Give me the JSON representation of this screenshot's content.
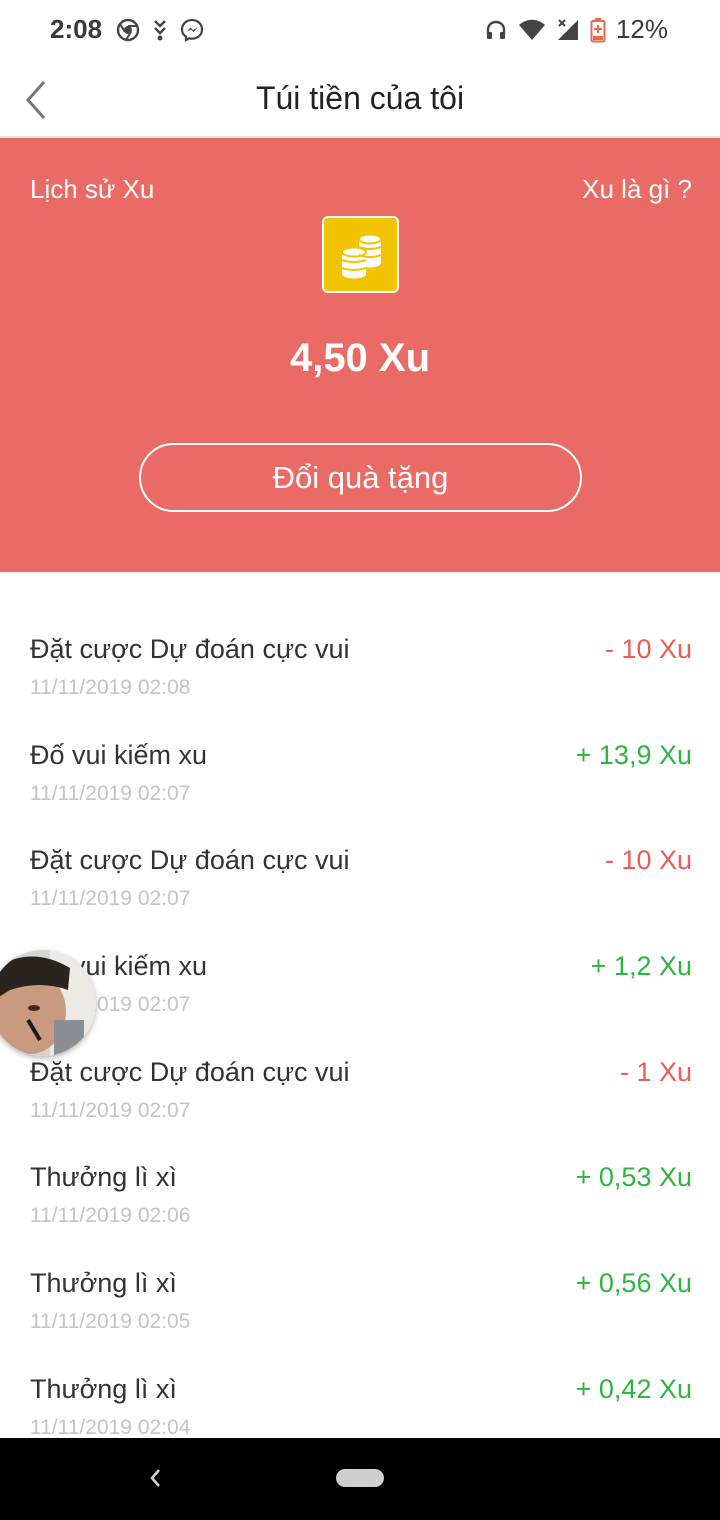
{
  "status_bar": {
    "time": "2:08",
    "battery": "12%",
    "left_icons": [
      "chrome-icon",
      "download-icon",
      "messenger-icon"
    ],
    "right_icons": [
      "headphones-icon",
      "wifi-icon",
      "signal-icon",
      "battery-icon"
    ]
  },
  "header": {
    "title": "Túi tiền của tôi",
    "back_icon": "chevron-left-icon"
  },
  "wallet": {
    "history_label": "Lịch sử Xu",
    "help_label": "Xu là gì ?",
    "balance": "4,50 Xu",
    "redeem_label": "Đổi quà tặng",
    "accent_color": "#ea6b66",
    "coin_color": "#f2c400"
  },
  "transactions": [
    {
      "title": "Đặt cược Dự đoán cực vui",
      "time": "11/11/2019 02:08",
      "amount": "- 10 Xu",
      "type": "neg"
    },
    {
      "title": "Đố vui kiếm xu",
      "time": "11/11/2019 02:07",
      "amount": "+ 13,9 Xu",
      "type": "pos"
    },
    {
      "title": "Đặt cược Dự đoán cực vui",
      "time": "11/11/2019 02:07",
      "amount": "- 10 Xu",
      "type": "neg"
    },
    {
      "title": "Đố vui kiếm xu",
      "time": "11/11/2019 02:07",
      "amount": "+ 1,2 Xu",
      "type": "pos"
    },
    {
      "title": "Đặt cược Dự đoán cực vui",
      "time": "11/11/2019 02:07",
      "amount": "- 1 Xu",
      "type": "neg"
    },
    {
      "title": "Thưởng lì xì",
      "time": "11/11/2019 02:06",
      "amount": "+ 0,53 Xu",
      "type": "pos"
    },
    {
      "title": "Thưởng lì xì",
      "time": "11/11/2019 02:05",
      "amount": "+ 0,56 Xu",
      "type": "pos"
    },
    {
      "title": "Thưởng lì xì",
      "time": "11/11/2019 02:04",
      "amount": "+ 0,42 Xu",
      "type": "pos"
    }
  ],
  "colors": {
    "negative": "#ee5a55",
    "positive": "#2fb53f"
  }
}
